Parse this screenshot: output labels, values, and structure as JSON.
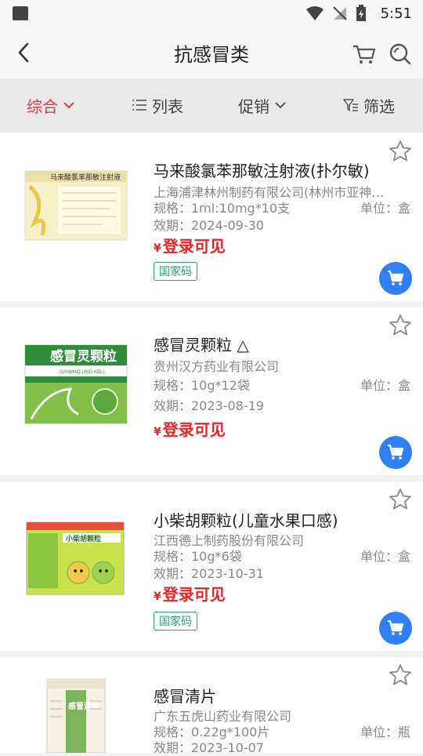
{
  "status_bar": {
    "time": "5:51"
  },
  "header": {
    "title": "抗感冒类"
  },
  "filter_bar": {
    "items": [
      {
        "label": "综合"
      },
      {
        "label": "列表"
      },
      {
        "label": "促销"
      },
      {
        "label": "筛选"
      }
    ]
  },
  "products": [
    {
      "name": "马来酸氯苯那敏注射液(扑尔敏)",
      "manufacturer": "上海浦津林州制药有限公司(林州市亚神…",
      "spec": "规格：1ml:10mg*10支",
      "unit": "单位：盒",
      "expiry": "效期：2024-09-30",
      "price_symbol": "¥",
      "price": "登录可见",
      "badge": "国家码",
      "thumb_title": "马来酸氯苯那敏注射液"
    },
    {
      "name": "感冒灵颗粒 △",
      "manufacturer": "贵州汉方药业有限公司",
      "spec": "规格：10g*12袋",
      "unit": "单位：盒",
      "expiry": "效期：2023-08-19",
      "price_symbol": "¥",
      "price": "登录可见",
      "thumb_title": "感冒灵颗粒",
      "thumb_sub": "GANMAO LING KELI"
    },
    {
      "name": "小柴胡颗粒(儿童水果口感)",
      "manufacturer": "江西德上制药股份有限公司",
      "spec": "规格：10g*6袋",
      "unit": "单位：盒",
      "expiry": "效期：2023-10-31",
      "price_symbol": "¥",
      "price": "登录可见",
      "badge": "国家码",
      "thumb_title": "小柴胡颗粒"
    },
    {
      "name": "感冒清片",
      "manufacturer": "广东五虎山药业有限公司",
      "spec": "规格：0.22g*100片",
      "unit": "单位：瓶",
      "expiry": "效期：2023-10-07",
      "thumb_title": "感冒清片"
    }
  ],
  "colors": {
    "accent": "#e33b3b",
    "price": "#e32626",
    "cart_button": "#2f7ff5",
    "badge": "#2aa37a"
  }
}
